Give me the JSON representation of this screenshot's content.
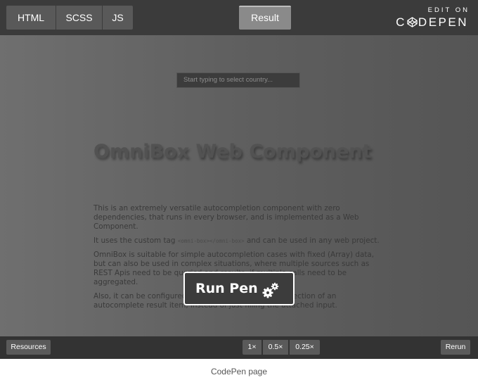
{
  "topbar": {
    "tabs": [
      {
        "label": "HTML"
      },
      {
        "label": "SCSS"
      },
      {
        "label": "JS"
      }
    ],
    "result_label": "Result",
    "brand": {
      "line1": "EDIT ON",
      "logo_left": "C",
      "logo_right": "DEPEN",
      "logo_icon": "codepen-cube-icon"
    }
  },
  "content": {
    "search": {
      "placeholder": "Start typing to select country..."
    },
    "title": "OmniBox Web Component",
    "paragraphs": {
      "p1": "This is an extremely versatile autocompletion component with zero dependencies, that runs in every browser, and is implemented as a Web Component.",
      "p2_before": "It uses the custom tag ",
      "p2_code": "<omni-box></omni-box>",
      "p2_after": " and can be used in any web project.",
      "p3": "OmniBox is suitable for simple autocompletion cases with fixed (Array) data, but can also be used in complex situations, where multiple sources such as REST Apis need to be queried and results, if multiple calls need to be aggregated.",
      "p4": "Also, it can be configured to call custom actions on selection of an autocomplete result item, instead of just filling the attached input."
    },
    "run_pen": {
      "label": "Run Pen",
      "icon": "gears-icon"
    }
  },
  "bottombar": {
    "resources_label": "Resources",
    "zoom_options": [
      "1×",
      "0.5×",
      "0.25×"
    ],
    "rerun_label": "Rerun"
  },
  "caption": "CodePen page",
  "colors": {
    "bar_background": "#3b3b3b",
    "tab_background": "#595959",
    "active_tab": "#8a8a8a"
  }
}
